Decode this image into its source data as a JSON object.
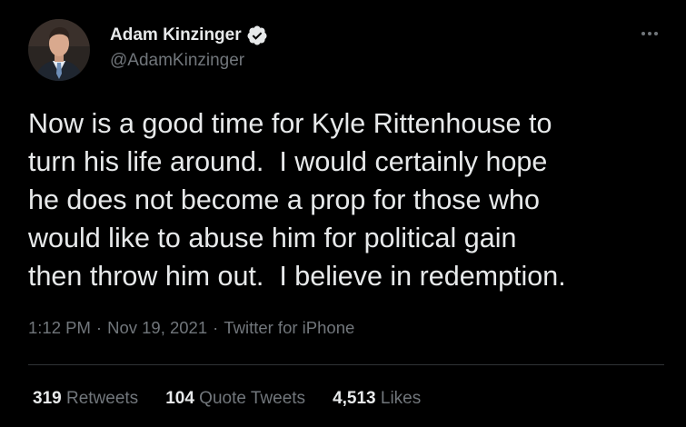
{
  "colors": {
    "background": "#000000",
    "primary_text": "#e7e9ea",
    "secondary_text": "#71767b",
    "divider": "#2f3336",
    "verified_badge": "#e7e9ea"
  },
  "author": {
    "display_name": "Adam Kinzinger",
    "handle": "@AdamKinzinger",
    "verified_icon": "verified-badge-icon",
    "avatar_icon": "profile-photo"
  },
  "menu": {
    "more_icon": "more-options-icon"
  },
  "tweet": {
    "text": "Now is a good time for Kyle Rittenhouse to\nturn his life around.  I would certainly hope\nhe does not become a prop for those who\nwould like to abuse him for political gain\nthen throw him out.  I believe in redemption."
  },
  "meta": {
    "time": "1:12 PM",
    "separator": "·",
    "date": "Nov 19, 2021",
    "source": "Twitter for iPhone"
  },
  "stats": {
    "retweets_count": "319",
    "retweets_label": "Retweets",
    "quotes_count": "104",
    "quotes_label": "Quote Tweets",
    "likes_count": "4,513",
    "likes_label": "Likes"
  }
}
